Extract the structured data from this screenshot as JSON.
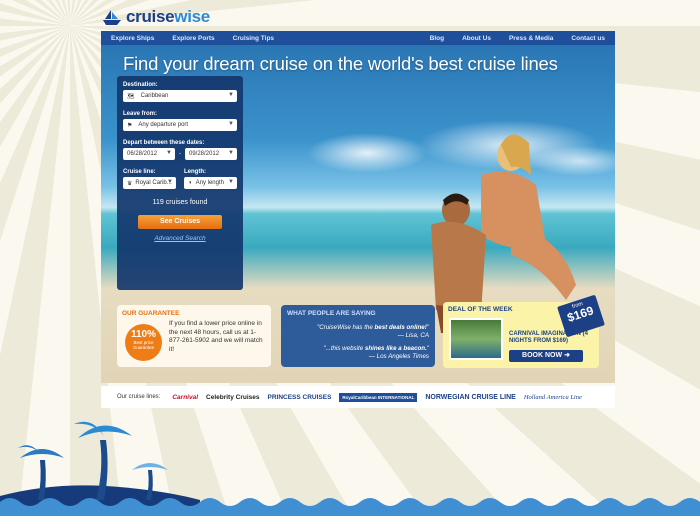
{
  "brand": {
    "logo_part1": "cruise",
    "logo_part2": "wise"
  },
  "nav": {
    "left": [
      "Explore Ships",
      "Explore Ports",
      "Cruising Tips"
    ],
    "right": [
      "Blog",
      "About Us",
      "Press & Media",
      "Contact us"
    ]
  },
  "hero": {
    "headline": "Find your dream cruise on the world's best cruise lines"
  },
  "search": {
    "destination_label": "Destination:",
    "destination_value": "Caribbean",
    "leave_label": "Leave from:",
    "leave_value": "Any departure port",
    "dates_label": "Depart between these dates:",
    "date_from": "06/28/2012",
    "date_to": "09/28/2012",
    "cruise_line_label": "Cruise line:",
    "cruise_line_value": "Royal Carib...",
    "length_label": "Length:",
    "length_value": "Any length",
    "count_text": "119 cruises found",
    "see_button": "See Cruises",
    "advanced_link": "Advanced Search"
  },
  "guarantee": {
    "title": "OUR GUARANTEE",
    "badge_pct": "110%",
    "badge_sub": "Best price Guarantee",
    "text": "If you find a lower price online in the next 48 hours, call us at 1-877-261-5902 and we will match it!"
  },
  "people": {
    "title": "WHAT PEOPLE ARE SAYING",
    "quote1_pre": "\"CruiseWise has the ",
    "quote1_bold": "best deals online!",
    "quote1_post": "\"",
    "quote1_author": "— Lisa, CA",
    "quote2_pre": "\"...this website ",
    "quote2_bold": "shines like a beacon.",
    "quote2_post": "\"",
    "quote2_author": "— Los Angeles Times"
  },
  "deal": {
    "title": "DEAL OF THE WEEK",
    "from": "from",
    "price": "$169",
    "name": "CARNIVAL IMAGINATION (4 NIGHTS FROM $169)",
    "book_button": "BOOK NOW"
  },
  "cruise_lines": {
    "label": "Our cruise lines:",
    "items": [
      "Carnival",
      "Celebrity Cruises",
      "PRINCESS CRUISES",
      "RoyalCaribbean INTERNATIONAL",
      "NORWEGIAN CRUISE LINE",
      "Holland America Line"
    ]
  },
  "colors": {
    "nav": "#1f4f9a",
    "accent": "#e56e10",
    "brand": "#1c3f86"
  }
}
